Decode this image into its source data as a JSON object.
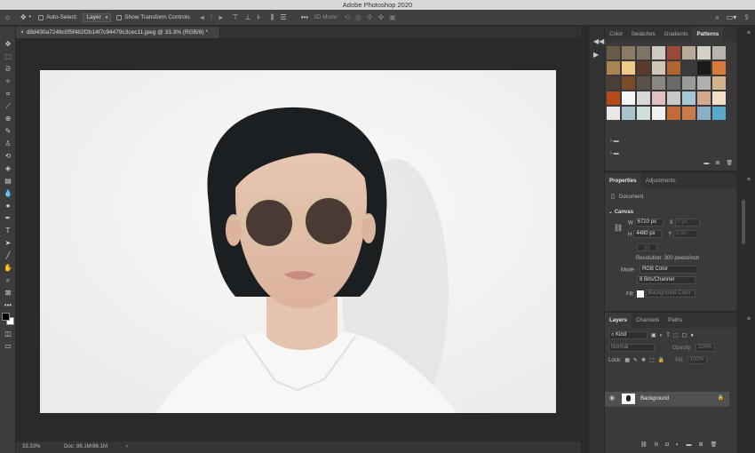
{
  "app": {
    "title": "Adobe Photoshop 2020"
  },
  "options_bar": {
    "auto_select_label": "Auto-Select:",
    "auto_select_value": "Layer",
    "show_transform_label": "Show Transform Controls",
    "mode_3d_label": "3D Mode:"
  },
  "document": {
    "tab_label": "d8d430a7248c0f5f482f2b14f7c94479c3cec11.jpeg @ 33.3% (RGB/8) *",
    "zoom": "33.33%",
    "doc_size": "Doc: 86.1M/86.1M"
  },
  "swatch_panel": {
    "tabs": [
      "Color",
      "Swatches",
      "Gradients",
      "Patterns"
    ],
    "active_tab": "Patterns",
    "pattern_colors": [
      "#6a5a48",
      "#8c7a62",
      "#7d7468",
      "#cfcac2",
      "#9b4a3a",
      "#b9a999",
      "#d6d1c8",
      "#b8b5ae",
      "#a88450",
      "#f0c98c",
      "#5a3a2a",
      "#cfc6b8",
      "#b0652e",
      "#3a3a3a",
      "#1a1a1a",
      "#d97a3a",
      "#4a3e36",
      "#7a4a2a",
      "#5a5248",
      "#8a8680",
      "#6a6a6a",
      "#9a9a9a",
      "#b0b0b0",
      "#d2b48c",
      "#b84a1a",
      "#f5f5f5",
      "#d8d8d8",
      "#e0c0c0",
      "#c8c8c8",
      "#a6c8d6",
      "#d4a890",
      "#f0e0c8",
      "#e8e8e8",
      "#a8c4c8",
      "#d0e0d8",
      "#f0f0f0",
      "#c46a3a",
      "#c87a4a",
      "#8ab0c8",
      "#58a8c8"
    ],
    "folders": [
      "",
      ""
    ]
  },
  "properties_panel": {
    "tabs": [
      "Properties",
      "Adjustments"
    ],
    "active_tab": "Properties",
    "document_label": "Document",
    "canvas_label": "Canvas",
    "w_label": "W",
    "w_value": "6720 px",
    "h_label": "H",
    "h_value": "4480 px",
    "x_label": "X",
    "x_placeholder": "0 px",
    "y_label": "Y",
    "y_placeholder": "0 px",
    "resolution": "Resolution: 300 pixels/inch",
    "mode_label": "Mode",
    "mode_value": "RGB Color",
    "depth_value": "8 Bits/Channel",
    "fill_label": "Fill",
    "fill_value": "Background Color"
  },
  "layers_panel": {
    "tabs": [
      "Layers",
      "Channels",
      "Paths"
    ],
    "active_tab": "Layers",
    "kind_label": "Kind",
    "blend_mode": "Normal",
    "opacity_label": "Opacity:",
    "opacity_value": "100%",
    "lock_label": "Lock:",
    "fill_label": "Fill:",
    "fill_value": "100%",
    "layers": [
      {
        "name": "Background",
        "visible": true,
        "locked": true
      }
    ]
  },
  "colors": {
    "foreground": "#000000",
    "background": "#ffffff",
    "photo_background": "#f2f2f1"
  }
}
